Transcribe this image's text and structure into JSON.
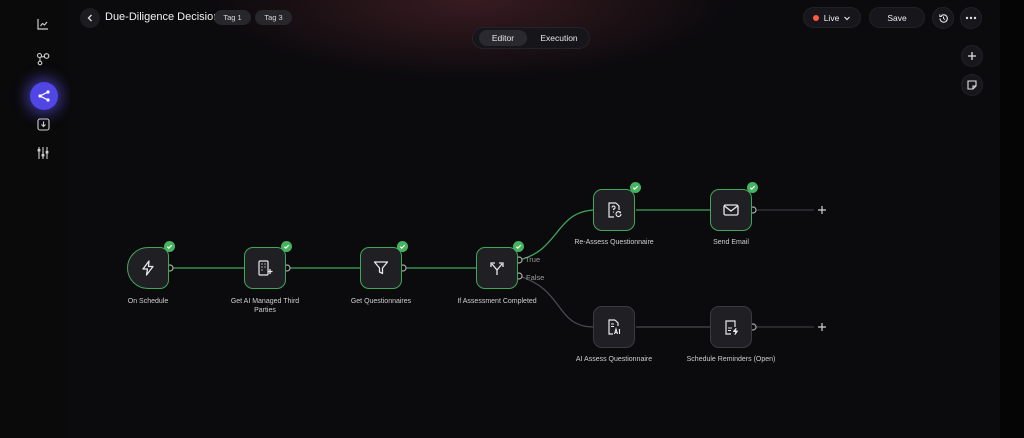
{
  "header": {
    "title": "Due-Diligence Decision",
    "tags": [
      "Tag 1",
      "Tag 3"
    ],
    "status_label": "Live",
    "save_label": "Save"
  },
  "view_toggle": {
    "tabs": [
      "Editor",
      "Execution"
    ],
    "active": "Editor"
  },
  "nodes": [
    {
      "label": "On Schedule",
      "icon": "lightning-icon",
      "status": "success"
    },
    {
      "label": "Get AI Managed Third Parties",
      "icon": "building-plus-icon",
      "status": "success"
    },
    {
      "label": "Get Questionnaires",
      "icon": "filter-icon",
      "status": "success"
    },
    {
      "label": "If Assessment Completed",
      "icon": "branch-icon",
      "status": "success"
    },
    {
      "label": "Re-Assess Questionnaire",
      "icon": "document-refresh-icon",
      "status": "success"
    },
    {
      "label": "Send Email",
      "icon": "mail-icon",
      "status": "success"
    },
    {
      "label": "AI Assess Questionnaire",
      "icon": "document-ai-icon",
      "status": "idle"
    },
    {
      "label": "Schedule Reminders (Open)",
      "icon": "document-lightning-icon",
      "status": "idle"
    }
  ],
  "branches": {
    "true_label": "True",
    "false_label": "False"
  },
  "colors": {
    "success": "#46b360",
    "accent": "#4f46e5",
    "live": "#ff5a3c"
  }
}
